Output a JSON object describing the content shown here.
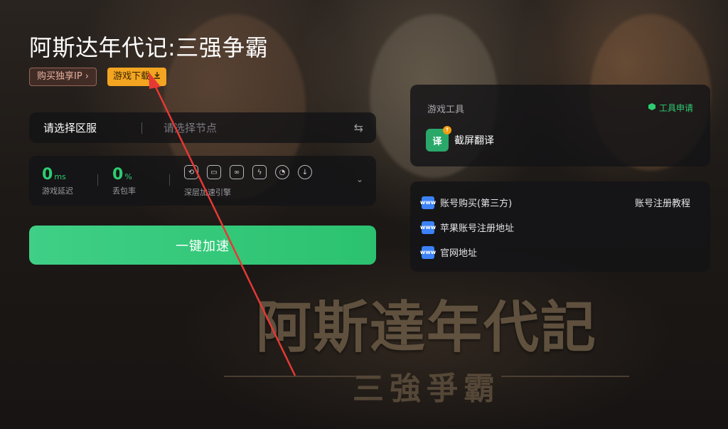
{
  "game": {
    "title": "阿斯达年代记:三强争霸",
    "buy_ip_label": "购买独享IP",
    "download_label": "游戏下载"
  },
  "background": {
    "title": "阿斯達年代記",
    "subtitle": "三強爭霸"
  },
  "region": {
    "label": "请选择区服",
    "node_placeholder": "请选择节点"
  },
  "stats": {
    "latency_value": "0",
    "latency_unit": "ms",
    "latency_label": "游戏延迟",
    "loss_value": "0",
    "loss_unit": "%",
    "loss_label": "丢包率",
    "engine_label": "深层加速引擎",
    "engine_icons": [
      "loop-icon",
      "screen-icon",
      "link-icon",
      "bolt-icon",
      "gauge-icon",
      "download-circle-icon"
    ]
  },
  "accelerate_button": "一键加速",
  "tools": {
    "header": "游戏工具",
    "apply_label": "工具申请",
    "items": [
      {
        "label": "截屏翻译",
        "icon": "translate-icon",
        "icon_text": "译"
      }
    ]
  },
  "links": {
    "items": [
      {
        "label": "账号购买(第三方)",
        "icon": "www-icon"
      },
      {
        "label": "苹果账号注册地址",
        "icon": "www-icon"
      },
      {
        "label": "官网地址",
        "icon": "www-icon"
      }
    ],
    "tutorial_label": "账号注册教程"
  },
  "colors": {
    "accent_green": "#2ecc71",
    "download_orange": "#f3a521",
    "annotation_red": "#e53935"
  }
}
